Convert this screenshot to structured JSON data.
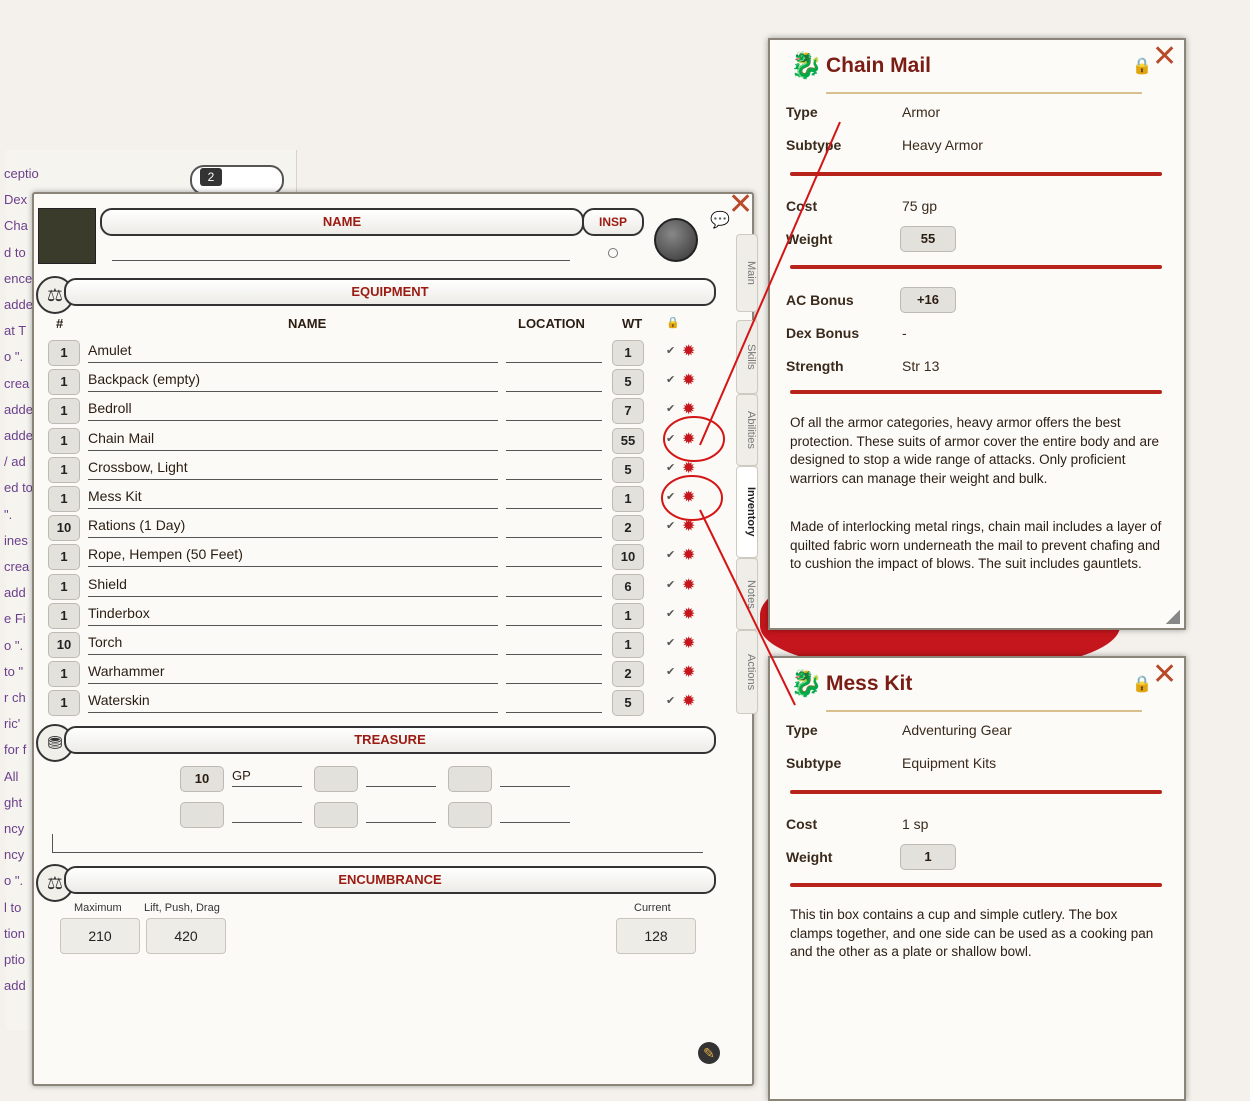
{
  "background_sheet": {
    "side_fragments": [
      "ceptio",
      "Dex",
      "Cha",
      "d to",
      "ence",
      "adde",
      "at T",
      "o \".",
      "crea",
      "adde",
      "adde",
      "/ ad",
      "ed to",
      "\".",
      "ines",
      "crea",
      "add",
      "e Fi",
      "o \".",
      "to \"",
      "r ch",
      "ric'",
      "for f",
      "All",
      "ght",
      "ncy",
      "ncy",
      "o \".",
      "l to",
      "tion",
      "ptio",
      "add"
    ],
    "badge_value": "2"
  },
  "sheet": {
    "name_label": "NAME",
    "insp_label": "INSP",
    "equipment_label": "EQUIPMENT",
    "columns": {
      "count": "#",
      "name": "NAME",
      "location": "LOCATION",
      "weight": "WT"
    },
    "items": [
      {
        "count": "1",
        "name": "Amulet",
        "location": "",
        "weight": "1"
      },
      {
        "count": "1",
        "name": "Backpack (empty)",
        "location": "",
        "weight": "5"
      },
      {
        "count": "1",
        "name": "Bedroll",
        "location": "",
        "weight": "7"
      },
      {
        "count": "1",
        "name": "Chain Mail",
        "location": "",
        "weight": "55"
      },
      {
        "count": "1",
        "name": "Crossbow, Light",
        "location": "",
        "weight": "5"
      },
      {
        "count": "1",
        "name": "Mess Kit",
        "location": "",
        "weight": "1"
      },
      {
        "count": "10",
        "name": "Rations (1 Day)",
        "location": "",
        "weight": "2"
      },
      {
        "count": "1",
        "name": "Rope, Hempen (50 Feet)",
        "location": "",
        "weight": "10"
      },
      {
        "count": "1",
        "name": "Shield",
        "location": "",
        "weight": "6"
      },
      {
        "count": "1",
        "name": "Tinderbox",
        "location": "",
        "weight": "1"
      },
      {
        "count": "10",
        "name": "Torch",
        "location": "",
        "weight": "1"
      },
      {
        "count": "1",
        "name": "Warhammer",
        "location": "",
        "weight": "2"
      },
      {
        "count": "1",
        "name": "Waterskin",
        "location": "",
        "weight": "5"
      }
    ],
    "treasure_label": "TREASURE",
    "coins": [
      {
        "amount": "10",
        "type": "GP"
      },
      {
        "amount": "",
        "type": ""
      },
      {
        "amount": "",
        "type": ""
      },
      {
        "amount": "",
        "type": ""
      },
      {
        "amount": "",
        "type": ""
      },
      {
        "amount": "",
        "type": ""
      }
    ],
    "encumbrance_label": "ENCUMBRANCE",
    "encumbrance": {
      "maximum_label": "Maximum",
      "maximum": "210",
      "lift_label": "Lift, Push, Drag",
      "lift": "420",
      "current_label": "Current",
      "current": "128"
    },
    "tabs": [
      "Main",
      "Skills",
      "Abilities",
      "Inventory",
      "Notes",
      "Actions"
    ],
    "icons": {
      "row_check": "check-icon",
      "row_red": "red-dragon-icon"
    }
  },
  "chain_mail_popup": {
    "title": "Chain Mail",
    "type_label": "Type",
    "type": "Armor",
    "subtype_label": "Subtype",
    "subtype": "Heavy Armor",
    "cost_label": "Cost",
    "cost": "75 gp",
    "weight_label": "Weight",
    "weight": "55",
    "ac_label": "AC Bonus",
    "ac": "+16",
    "dex_label": "Dex Bonus",
    "dex": "-",
    "strength_label": "Strength",
    "strength": "Str 13",
    "desc1": "Of all the armor categories, heavy armor offers the best protection. These suits of armor cover the entire body and are designed to stop a wide range of attacks. Only proficient warriors can manage their weight and bulk.",
    "desc2": "Made of interlocking metal rings, chain mail includes a layer of quilted fabric worn underneath the mail to prevent chafing and to cushion the impact of blows. The suit includes gauntlets."
  },
  "mess_kit_popup": {
    "title": "Mess Kit",
    "type_label": "Type",
    "type": "Adventuring Gear",
    "subtype_label": "Subtype",
    "subtype": "Equipment Kits",
    "cost_label": "Cost",
    "cost": "1 sp",
    "weight_label": "Weight",
    "weight": "1",
    "desc": "This tin box contains a cup and simple cutlery. The box clamps together, and one side can be used as a cooking pan and the other as a plate or shallow bowl."
  },
  "colors": {
    "accent_red": "#c4161c",
    "title_red": "#9b1b12",
    "parchment": "#f4f1ec"
  }
}
